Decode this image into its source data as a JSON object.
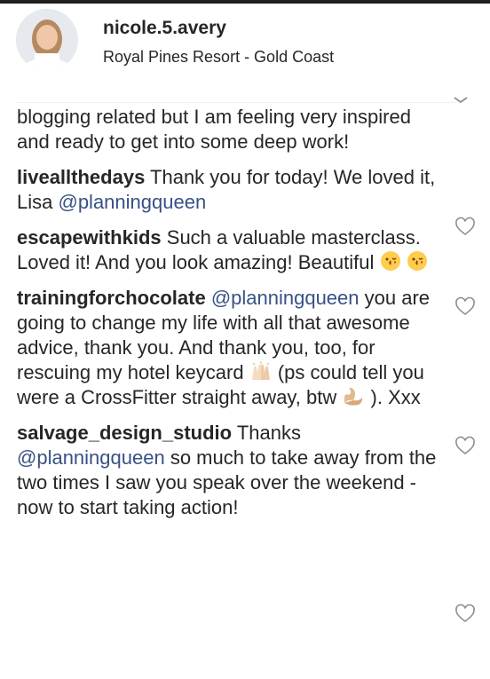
{
  "header": {
    "username": "nicole.5.avery",
    "location": "Royal Pines Resort - Gold Coast"
  },
  "comments": [
    {
      "text": "blogging related but I am feeling very inspired and ready to get into some deep work!"
    },
    {
      "user": "liveallthedays",
      "text_a": "Thank you for today! We loved it, Lisa",
      "mention": "@planningqueen"
    },
    {
      "user": "escapewithkids",
      "text_a": "Such a valuable masterclass. Loved it! And you look amazing! Beautiful"
    },
    {
      "user": "trainingforchocolate",
      "mention": "@planningqueen",
      "text_a": "you are going to change my life with all that awesome advice, thank you. And thank you, too, for rescuing my hotel keycard",
      "text_b": "(ps could tell you were a CrossFitter straight away, btw",
      "text_c": "). Xxx"
    },
    {
      "user": "salvage_design_studio",
      "text_a": "Thanks",
      "mention": "@planningqueen",
      "text_b": "so much to take away from the two times I saw you speak over the weekend - now to start taking action!"
    }
  ],
  "icons": {
    "heart": "heart-outline-icon",
    "chevron": "chevron-down-icon",
    "emoji_kiss": "face-blowing-kiss",
    "emoji_hands": "raising-hands",
    "emoji_muscle": "flexed-biceps"
  }
}
